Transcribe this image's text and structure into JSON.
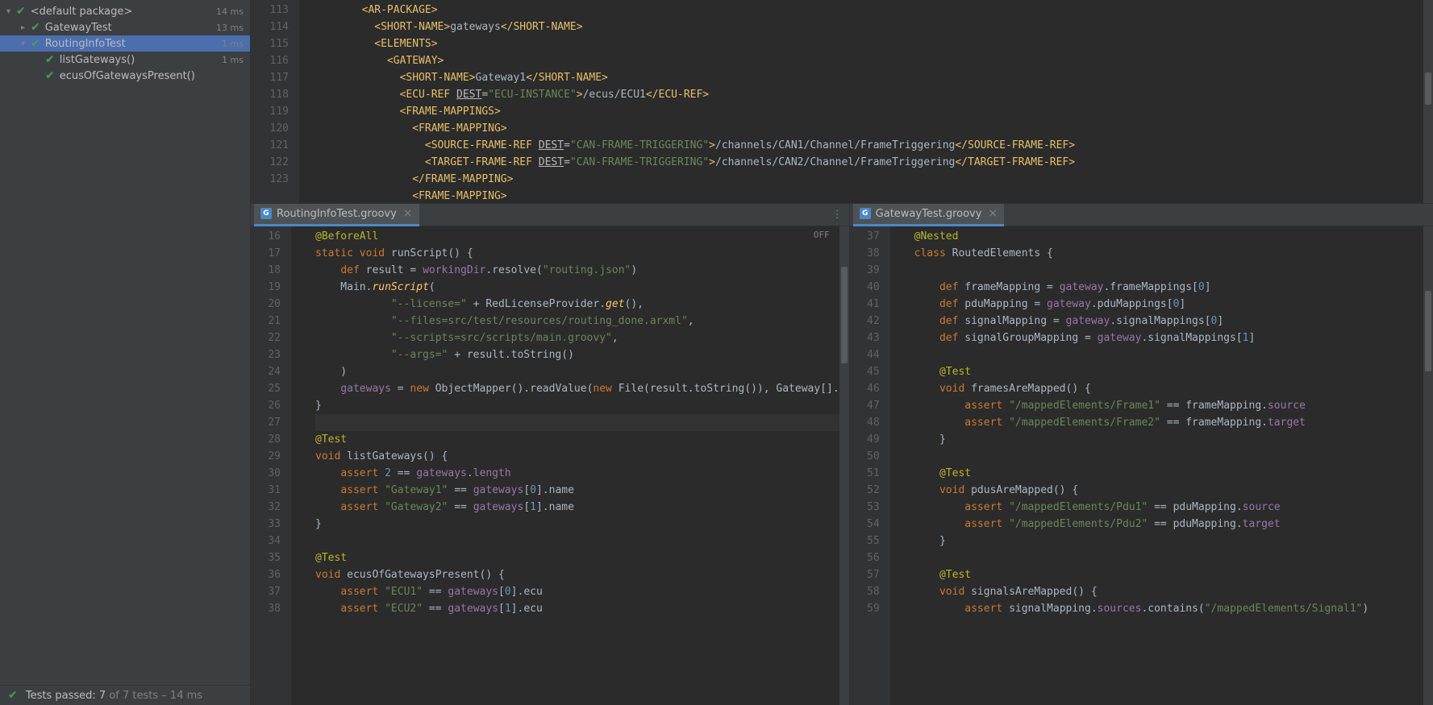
{
  "testTree": {
    "root": {
      "label": "<default package>",
      "time": "14 ms",
      "expanded": true
    },
    "items": [
      {
        "label": "GatewayTest",
        "time": "13 ms",
        "indent": 1,
        "chev": "▸"
      },
      {
        "label": "RoutingInfoTest",
        "time": "1 ms",
        "indent": 1,
        "chev": "▾",
        "sel": true
      },
      {
        "label": "listGateways()",
        "time": "1 ms",
        "indent": 2
      },
      {
        "label": "ecusOfGatewaysPresent()",
        "time": "",
        "indent": 2
      }
    ]
  },
  "statusBar": {
    "pre": "Tests passed: ",
    "passed": "7",
    "mid": " of ",
    "total": "7 tests",
    "dash": " – ",
    "time": "14 ms"
  },
  "topEditor": {
    "gutterStart": 113,
    "lines": [
      {
        "n": "",
        "html": "        <span class='tag'>&lt;AR-PACKAGE&gt;</span>"
      },
      {
        "n": 113,
        "html": "          <span class='tag'>&lt;SHORT-NAME&gt;</span>gateways<span class='tag'>&lt;/SHORT-NAME&gt;</span>"
      },
      {
        "n": 114,
        "html": "          <span class='tag'>&lt;ELEMENTS&gt;</span>"
      },
      {
        "n": 115,
        "html": "            <span class='tag'>&lt;GATEWAY&gt;</span>"
      },
      {
        "n": 116,
        "html": "              <span class='tag'>&lt;SHORT-NAME&gt;</span>Gateway1<span class='tag'>&lt;/SHORT-NAME&gt;</span>"
      },
      {
        "n": 117,
        "html": "              <span class='tag'>&lt;ECU-REF </span><span class='attr'><u>DEST</u>=</span><span class='str'>\"ECU-INSTANCE\"</span><span class='tag'>&gt;</span>/ecus/ECU1<span class='tag'>&lt;/ECU-REF&gt;</span>"
      },
      {
        "n": 118,
        "html": "              <span class='tag'>&lt;FRAME-MAPPINGS&gt;</span>"
      },
      {
        "n": 119,
        "html": "                <span class='tag'>&lt;FRAME-MAPPING&gt;</span>"
      },
      {
        "n": 120,
        "html": "                  <span class='tag'>&lt;SOURCE-FRAME-REF </span><span class='attr'><u>DEST</u>=</span><span class='str'>\"CAN-FRAME-TRIGGERING\"</span><span class='tag'>&gt;</span>/channels/CAN1/Channel/FrameTriggering<span class='tag'>&lt;/SOURCE-FRAME-REF&gt;</span>"
      },
      {
        "n": 121,
        "html": "                  <span class='tag'>&lt;TARGET-FRAME-REF </span><span class='attr'><u>DEST</u>=</span><span class='str'>\"CAN-FRAME-TRIGGERING\"</span><span class='tag'>&gt;</span>/channels/CAN2/Channel/FrameTriggering<span class='tag'>&lt;/TARGET-FRAME-REF&gt;</span>"
      },
      {
        "n": 122,
        "html": "                <span class='tag'>&lt;/FRAME-MAPPING&gt;</span>"
      },
      {
        "n": 123,
        "html": "                <span class='tag'>&lt;FRAME-MAPPING&gt;</span>"
      }
    ]
  },
  "leftTab": {
    "file": "RoutingInfoTest.groovy",
    "icon": "G"
  },
  "rightTab": {
    "file": "GatewayTest.groovy",
    "icon": "G"
  },
  "offLabel": "OFF",
  "leftEditor": {
    "lines": [
      {
        "n": 16,
        "html": "<span class='anno'>@BeforeAll</span>"
      },
      {
        "n": 17,
        "html": "<span class='kw'>static void</span> runScript() {"
      },
      {
        "n": 18,
        "html": "    <span class='kw'>def</span> result = <span class='fld'>workingDir</span>.resolve(<span class='str'>\"routing.json\"</span>)"
      },
      {
        "n": 19,
        "html": "    Main.<span class='fn'>runScript</span>("
      },
      {
        "n": 20,
        "html": "            <span class='str'>\"--license=\"</span> + RedLicenseProvider.<span class='fn'>get</span>(),"
      },
      {
        "n": 21,
        "html": "            <span class='str'>\"--files=src/test/resources/routing_done.arxml\"</span>,"
      },
      {
        "n": 22,
        "html": "            <span class='str'>\"--scripts=src/scripts/main.groovy\"</span>,"
      },
      {
        "n": 23,
        "html": "            <span class='str'>\"--args=\"</span> + result.toString()"
      },
      {
        "n": 24,
        "html": "    )"
      },
      {
        "n": 25,
        "html": "    <span class='fld'>gateways</span> = <span class='kw'>new</span> ObjectMapper().readValue(<span class='kw'>new</span> File(result.toString()), Gateway[]."
      },
      {
        "n": 26,
        "html": "}"
      },
      {
        "n": 27,
        "hl": true,
        "html": ""
      },
      {
        "n": 28,
        "html": "<span class='anno'>@Test</span>"
      },
      {
        "n": 29,
        "html": "<span class='kw'>void</span> listGateways() {"
      },
      {
        "n": 30,
        "html": "    <span class='kw'>assert</span> <span class='num'>2</span> == <span class='fld'>gateways</span>.<span class='fld'>length</span>"
      },
      {
        "n": 31,
        "html": "    <span class='kw'>assert</span> <span class='str'>\"Gateway1\"</span> == <span class='fld'>gateways</span>[<span class='num'>0</span>].name"
      },
      {
        "n": 32,
        "html": "    <span class='kw'>assert</span> <span class='str'>\"Gateway2\"</span> == <span class='fld'>gateways</span>[<span class='num'>1</span>].name"
      },
      {
        "n": 33,
        "html": "}"
      },
      {
        "n": 34,
        "html": ""
      },
      {
        "n": 35,
        "html": "<span class='anno'>@Test</span>"
      },
      {
        "n": 36,
        "html": "<span class='kw'>void</span> ecusOfGatewaysPresent() {"
      },
      {
        "n": 37,
        "html": "    <span class='kw'>assert</span> <span class='str'>\"ECU1\"</span> == <span class='fld'>gateways</span>[<span class='num'>0</span>].ecu"
      },
      {
        "n": 38,
        "html": "    <span class='kw'>assert</span> <span class='str'>\"ECU2\"</span> == <span class='fld'>gateways</span>[<span class='num'>1</span>].ecu"
      }
    ]
  },
  "rightEditor": {
    "lines": [
      {
        "n": 37,
        "html": "<span class='anno'>@Nested</span>"
      },
      {
        "n": 38,
        "html": "<span class='kw'>class</span> RoutedElements {"
      },
      {
        "n": 39,
        "html": ""
      },
      {
        "n": 40,
        "html": "    <span class='kw'>def</span> frameMapping = <span class='fld'>gateway</span>.frameMappings[<span class='num'>0</span>]"
      },
      {
        "n": 41,
        "html": "    <span class='kw'>def</span> pduMapping = <span class='fld'>gateway</span>.pduMappings[<span class='num'>0</span>]"
      },
      {
        "n": 42,
        "html": "    <span class='kw'>def</span> signalMapping = <span class='fld'>gateway</span>.signalMappings[<span class='num'>0</span>]"
      },
      {
        "n": 43,
        "html": "    <span class='kw'>def</span> signalGroupMapping = <span class='fld'>gateway</span>.signalMappings[<span class='num'>1</span>]"
      },
      {
        "n": 44,
        "html": ""
      },
      {
        "n": 45,
        "html": "    <span class='anno'>@Test</span>"
      },
      {
        "n": 46,
        "html": "    <span class='kw'>void</span> framesAreMapped() {"
      },
      {
        "n": 47,
        "html": "        <span class='kw'>assert</span> <span class='str'>\"/mappedElements/Frame1\"</span> == frameMapping.<span class='fld'>source</span>"
      },
      {
        "n": 48,
        "html": "        <span class='kw'>assert</span> <span class='str'>\"/mappedElements/Frame2\"</span> == frameMapping.<span class='fld'>target</span>"
      },
      {
        "n": 49,
        "html": "    }"
      },
      {
        "n": 50,
        "html": ""
      },
      {
        "n": 51,
        "html": "    <span class='anno'>@Test</span>"
      },
      {
        "n": 52,
        "html": "    <span class='kw'>void</span> pdusAreMapped() {"
      },
      {
        "n": 53,
        "html": "        <span class='kw'>assert</span> <span class='str'>\"/mappedElements/Pdu1\"</span> == pduMapping.<span class='fld'>source</span>"
      },
      {
        "n": 54,
        "html": "        <span class='kw'>assert</span> <span class='str'>\"/mappedElements/Pdu2\"</span> == pduMapping.<span class='fld'>target</span>"
      },
      {
        "n": 55,
        "html": "    }"
      },
      {
        "n": 56,
        "html": ""
      },
      {
        "n": 57,
        "html": "    <span class='anno'>@Test</span>"
      },
      {
        "n": 58,
        "html": "    <span class='kw'>void</span> signalsAreMapped() {"
      },
      {
        "n": 59,
        "html": "        <span class='kw'>assert</span> signalMapping.<span class='fld'>sources</span>.contains(<span class='str'>\"/mappedElements/Signal1\"</span>)"
      }
    ]
  }
}
